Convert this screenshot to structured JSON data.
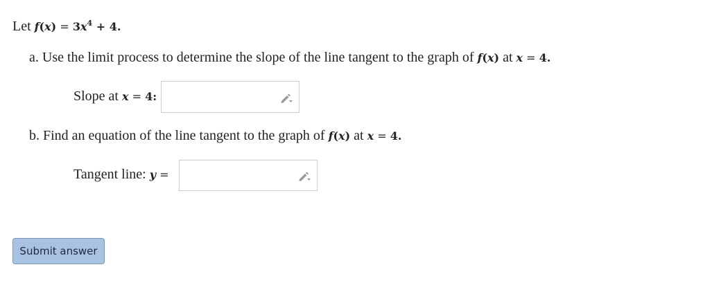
{
  "question": {
    "intro": {
      "prefix": "Let ",
      "function_name": "f",
      "function_arg_open": "(",
      "function_var": "x",
      "function_arg_close": ")",
      "equals": " = ",
      "coefficient": "3",
      "term_var": "x",
      "exponent": "4",
      "rest": " + 4",
      "end": "."
    },
    "part_a": {
      "prompt_text": "a. Use the limit process to determine the slope of the line tangent to the graph of ",
      "at_text": " at ",
      "value": "4",
      "end": "."
    },
    "slope_field": {
      "label_text": "Slope at ",
      "label_var": "x",
      "label_value": "4",
      "label_colon": ":",
      "value": ""
    },
    "part_b": {
      "prompt_text": "b. Find an equation of the line tangent to the graph of ",
      "at_text": " at ",
      "value": "4",
      "end": "."
    },
    "tangent_field": {
      "label_text": "Tangent line: ",
      "label_var": "y",
      "label_equals": " =",
      "value": ""
    }
  },
  "actions": {
    "submit_label": "Submit answer"
  },
  "icons": {
    "slope_editor": "pencil-icon",
    "tangent_editor": "pencil-icon"
  },
  "colors": {
    "submit_bg": "#a8c3e2",
    "submit_border": "#7e97b4",
    "input_border": "#cfcfcf",
    "pencil": "#9a9a9a"
  }
}
